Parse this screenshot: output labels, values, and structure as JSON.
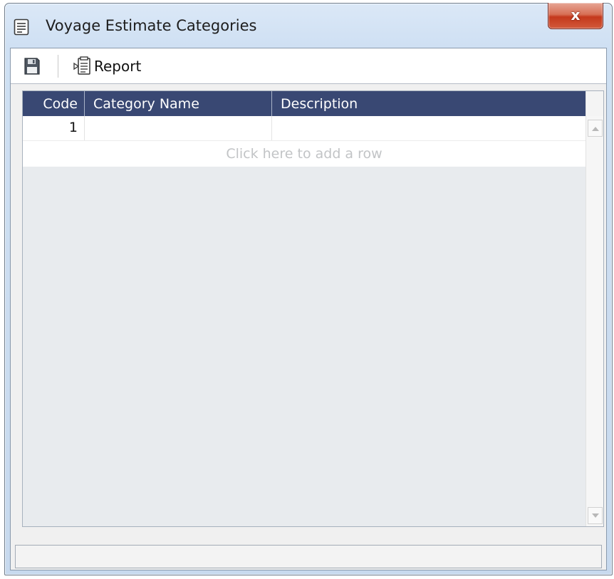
{
  "window": {
    "title": "Voyage Estimate Categories",
    "title_icon": "document-list-icon",
    "close_label": "x"
  },
  "toolbar": {
    "save_icon": "floppy-disk-icon",
    "report_icon": "report-icon",
    "report_label": "Report"
  },
  "grid": {
    "columns": [
      "Code",
      "Category Name",
      "Description"
    ],
    "rows": [
      {
        "code": "1",
        "category_name": "",
        "description": ""
      }
    ],
    "add_row_text": "Click here to add a row"
  },
  "status_bar": {
    "text": ""
  },
  "colors": {
    "header_bg": "#394873",
    "header_text": "#ffffff",
    "close_button": "#c4381c",
    "grid_bg": "#e8ebee",
    "add_row_text": "#c2c4c6"
  }
}
